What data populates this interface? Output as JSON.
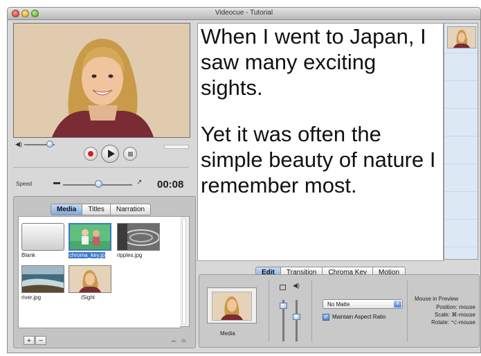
{
  "window": {
    "title": "Videocue - Tutorial"
  },
  "colors": {
    "accent": "#3a78c8",
    "record": "#d41f1f",
    "cue_strip": "#dde8f5"
  },
  "player": {
    "icons": [
      "volume-icon",
      "record-icon",
      "play-icon",
      "stop-icon"
    ],
    "speed_label": "Speed",
    "time": "00:08"
  },
  "media_tabs": {
    "items": [
      "Media",
      "Titles",
      "Narration"
    ],
    "selected": "Media"
  },
  "media_items": [
    {
      "label": "Blank"
    },
    {
      "label": "chroma_key.jp",
      "selected": true
    },
    {
      "label": "ripples.jpg"
    },
    {
      "label": "river.jpg"
    },
    {
      "label": "iSight"
    }
  ],
  "media_controls": {
    "add": "+",
    "remove": "−"
  },
  "script": {
    "paragraph1": "When I went to Japan, I saw many exciting sights.",
    "paragraph2": "Yet it was often the simple beauty of nature I remember most."
  },
  "edit_tabs": {
    "items": [
      "Edit",
      "Transition",
      "Chroma Key",
      "Motion"
    ],
    "selected": "Edit"
  },
  "edit": {
    "media_caption": "Media",
    "matte_value": "No Matte",
    "aspect_checked": true,
    "aspect_label": "Maintain Aspect Ratio"
  },
  "mouse_preview": {
    "title": "Mouse in Preview",
    "position": "Position: mouse",
    "scale": "Scale: ⌘-mouse",
    "rotate": "Rotate: ⌥-mouse"
  }
}
